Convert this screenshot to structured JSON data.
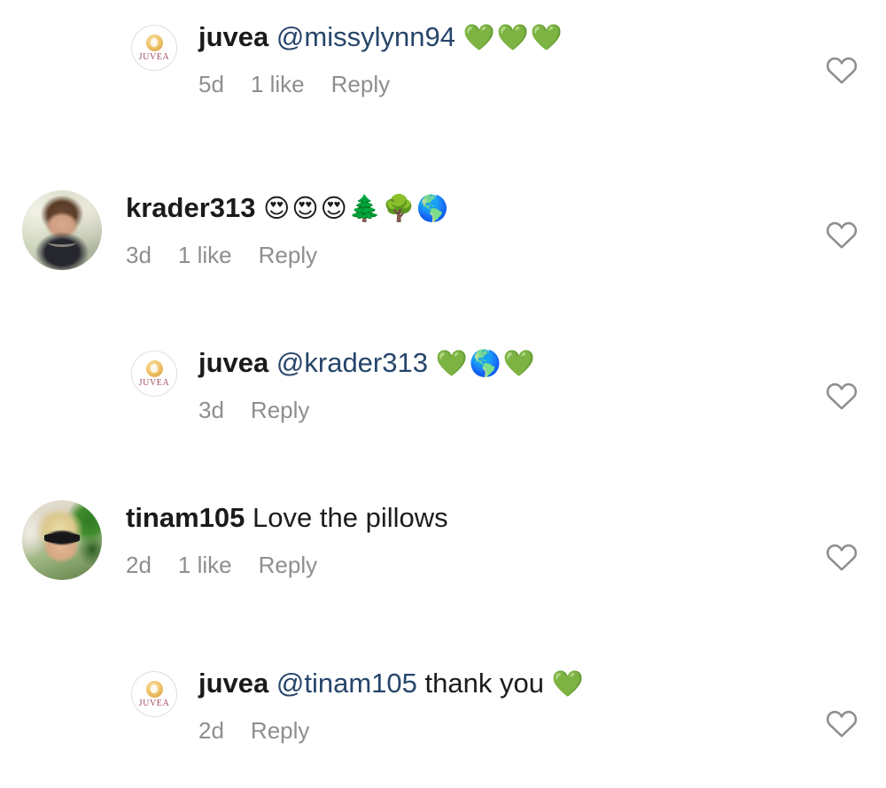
{
  "app": {
    "screen": "instagram-comments",
    "background_color": "#ffffff",
    "link_color": "#27456b",
    "username_color": "#1a1a1a",
    "meta_color": "#8e8e8e",
    "heart_outline_color": "#8e8e8e",
    "green_heart_color": "#3ec72f"
  },
  "comments": [
    {
      "id": "c1",
      "level": "reply",
      "avatar": {
        "type": "brand-logo",
        "name": "juvea-avatar",
        "wordmark": "JUVEA"
      },
      "username": "juvea",
      "mention": "@missylynn94",
      "text": "",
      "emojis": "💚💚💚",
      "emoji_names": [
        "green-heart",
        "green-heart",
        "green-heart"
      ],
      "time": "5d",
      "likes": "1 like",
      "reply": "Reply",
      "like_icon": "heart-outline-icon"
    },
    {
      "id": "c2",
      "level": "top",
      "avatar": {
        "type": "photo",
        "name": "krader313-avatar",
        "wordmark": ""
      },
      "username": "krader313",
      "mention": "",
      "text": "",
      "emojis": "😍😍😍🌲🌳🌎",
      "emoji_names": [
        "heart-eyes",
        "heart-eyes",
        "heart-eyes",
        "evergreen-tree",
        "deciduous-tree",
        "earth-globe-americas"
      ],
      "time": "3d",
      "likes": "1 like",
      "reply": "Reply",
      "like_icon": "heart-outline-icon"
    },
    {
      "id": "c3",
      "level": "reply",
      "avatar": {
        "type": "brand-logo",
        "name": "juvea-avatar",
        "wordmark": "JUVEA"
      },
      "username": "juvea",
      "mention": "@krader313",
      "text": "",
      "emojis": "💚🌎💚",
      "emoji_names": [
        "green-heart",
        "earth-globe-americas",
        "green-heart"
      ],
      "time": "3d",
      "likes": "",
      "reply": "Reply",
      "like_icon": "heart-outline-icon"
    },
    {
      "id": "c4",
      "level": "top",
      "avatar": {
        "type": "photo",
        "name": "tinam105-avatar",
        "wordmark": ""
      },
      "username": "tinam105",
      "mention": "",
      "text": "Love the pillows",
      "emojis": "",
      "emoji_names": [],
      "time": "2d",
      "likes": "1 like",
      "reply": "Reply",
      "like_icon": "heart-outline-icon"
    },
    {
      "id": "c5",
      "level": "reply",
      "avatar": {
        "type": "brand-logo",
        "name": "juvea-avatar",
        "wordmark": "JUVEA"
      },
      "username": "juvea",
      "mention": "@tinam105",
      "text": "thank you",
      "emojis": "💚",
      "emoji_names": [
        "green-heart"
      ],
      "time": "2d",
      "likes": "",
      "reply": "Reply",
      "like_icon": "heart-outline-icon"
    }
  ]
}
